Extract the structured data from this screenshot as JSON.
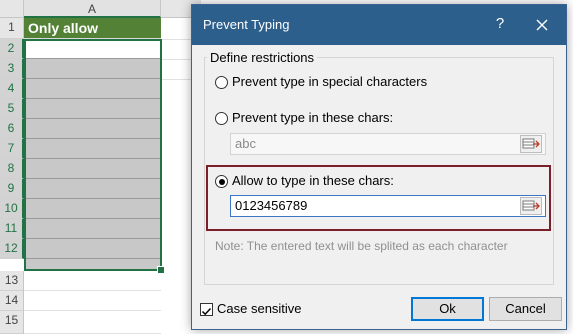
{
  "sheet": {
    "column_header": "A",
    "header_cell": "Only allow numbers",
    "row_numbers": [
      "1",
      "2",
      "3",
      "4",
      "5",
      "6",
      "7",
      "8",
      "9",
      "10",
      "11",
      "12",
      "13",
      "14",
      "15"
    ]
  },
  "dialog": {
    "title": "Prevent Typing",
    "help_label": "?",
    "group_label": "Define restrictions",
    "option_special": "Prevent type in special characters",
    "option_these": "Prevent type in these chars:",
    "these_value": "abc",
    "option_allow": "Allow to type in these chars:",
    "allow_value": "0123456789",
    "note": "Note: The entered text will be splited as each character",
    "case_sensitive": "Case sensitive",
    "case_sensitive_checked": true,
    "ok_label": "Ok",
    "cancel_label": "Cancel",
    "selected_option": "allow"
  },
  "colors": {
    "header_fill": "#538135",
    "selection": "#217346",
    "titlebar": "#2d5f8c",
    "highlight_border": "#7b1f2a"
  },
  "icons": {
    "close": "close-icon",
    "range_picker": "range-picker-icon",
    "checkmark": "checkmark-icon"
  }
}
